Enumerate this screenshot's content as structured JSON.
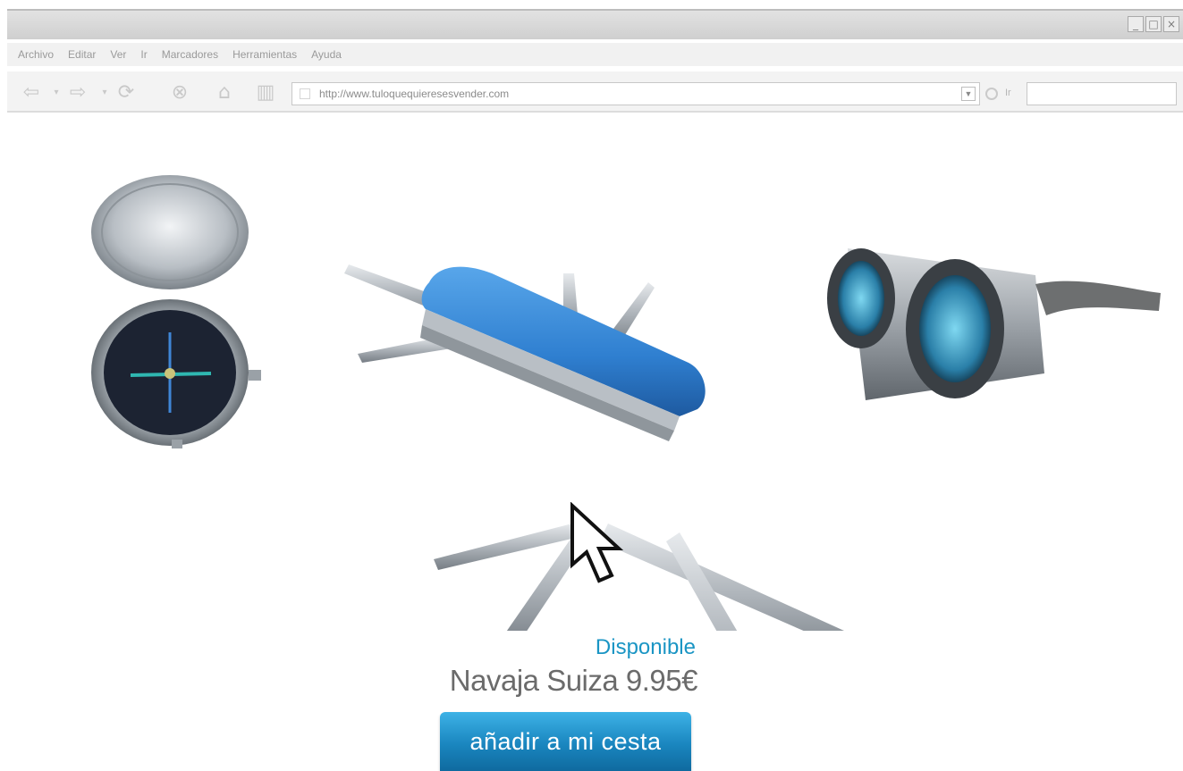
{
  "window": {
    "controls": [
      "_",
      "□",
      "×"
    ]
  },
  "menu": [
    "Archivo",
    "Editar",
    "Ver",
    "Ir",
    "Marcadores",
    "Herramientas",
    "Ayuda"
  ],
  "toolbar": {
    "url": "http://www.tuloquequieresesvender.com",
    "go_label": "Ir"
  },
  "product": {
    "availability": "Disponible",
    "title": "Navaja Suiza 9.95€",
    "add_to_cart": "añadir a mi cesta"
  },
  "colors": {
    "accent": "#1a95c4",
    "button": "#1a86bf",
    "knife_blue": "#2f7fd0"
  }
}
